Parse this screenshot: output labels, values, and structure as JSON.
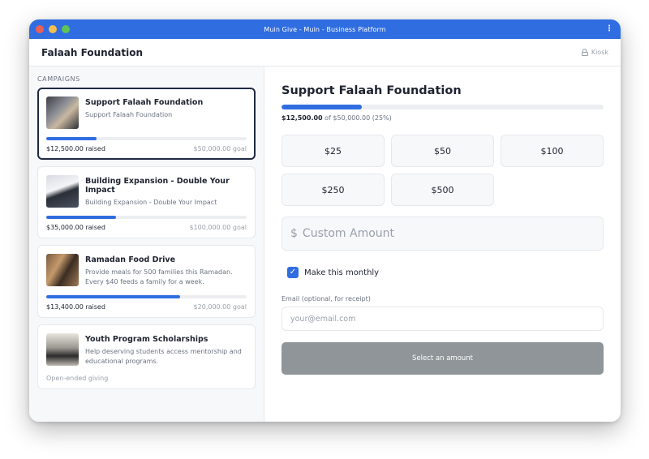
{
  "window": {
    "title": "Muin Give - Muin - Business Platform",
    "menu_icon": "⋮"
  },
  "header": {
    "org_name": "Falaah Foundation",
    "kiosk_label": "Kiosk"
  },
  "sidebar": {
    "section_label": "CAMPAIGNS",
    "campaigns": [
      {
        "title": "Support Falaah Foundation",
        "description": "Support Falaah Foundation",
        "progress": 0.25,
        "raised": "$12,500.00 raised",
        "goal": "$50,000.00 goal"
      },
      {
        "title": "Building Expansion - Double Your Impact",
        "description": "Building Expansion - Double Your Impact",
        "progress": 0.35,
        "raised": "$35,000.00 raised",
        "goal": "$100,000.00 goal"
      },
      {
        "title": "Ramadan Food Drive",
        "description": "Provide meals for 500 families this Ramadan. Every $40 feeds a family for a week.",
        "progress": 0.67,
        "raised": "$13,400.00 raised",
        "goal": "$20,000.00 goal"
      },
      {
        "title": "Youth Program Scholarships",
        "description": "Help deserving students access mentorship and educational programs.",
        "open_ended": "Open-ended giving"
      }
    ]
  },
  "main": {
    "title": "Support Falaah Foundation",
    "progress": 0.25,
    "raised_amount": "$12,500.00",
    "of_text": " of $50,000.00 (25%)",
    "amounts": [
      "$25",
      "$50",
      "$100",
      "$250",
      "$500"
    ],
    "custom": {
      "currency": "$",
      "placeholder": "Custom Amount"
    },
    "monthly_label": "Make this monthly",
    "monthly_checked": true,
    "email_label": "Email (optional, for receipt)",
    "email_placeholder": "your@email.com",
    "submit_label": "Select an amount"
  },
  "colors": {
    "brand": "#2f6de1",
    "selected_border": "#1f2a44",
    "disabled_button": "#8f9599"
  }
}
